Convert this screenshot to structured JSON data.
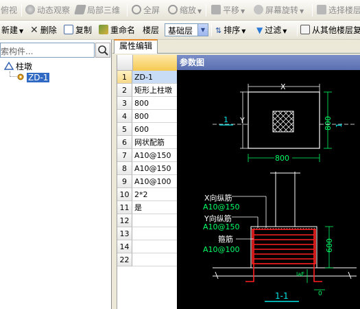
{
  "toolbar1": {
    "items": [
      {
        "label": "俯视",
        "icon": "top-view-icon"
      },
      {
        "label": "动态观察",
        "icon": "orbit-icon"
      },
      {
        "label": "局部三维",
        "icon": "local-3d-icon"
      },
      {
        "label": "全屏",
        "icon": "fullscreen-icon"
      },
      {
        "label": "缩放",
        "icon": "zoom-icon"
      },
      {
        "label": "平移",
        "icon": "pan-icon"
      },
      {
        "label": "屏幕旋转",
        "icon": "screen-rotate-icon"
      },
      {
        "label": "选择楼层",
        "icon": "select-floor-icon"
      }
    ]
  },
  "toolbar2": {
    "new_label": "新建",
    "delete_label": "删除",
    "copy_label": "复制",
    "rename_label": "重命名",
    "floor_label": "楼层",
    "floor_value": "基础层",
    "sort_label": "排序",
    "filter_label": "过滤",
    "copy_from_label": "从其他楼层复"
  },
  "left_panel": {
    "search_placeholder": "搜索构件...",
    "tree_root": "柱墩",
    "tree_child": "ZD-1"
  },
  "properties": {
    "tab_label": "属性编辑",
    "rows": [
      {
        "num": "1",
        "value": "ZD-1"
      },
      {
        "num": "2",
        "value": "矩形上柱墩"
      },
      {
        "num": "3",
        "value": "800"
      },
      {
        "num": "4",
        "value": "800"
      },
      {
        "num": "5",
        "value": "600"
      },
      {
        "num": "6",
        "value": "网状配筋"
      },
      {
        "num": "7",
        "value": "A10@150"
      },
      {
        "num": "8",
        "value": "A10@150"
      },
      {
        "num": "9",
        "value": "A10@100"
      },
      {
        "num": "10",
        "value": "2*2"
      },
      {
        "num": "11",
        "value": "是"
      },
      {
        "num": "12",
        "value": ""
      },
      {
        "num": "13",
        "value": ""
      },
      {
        "num": "14",
        "value": ""
      },
      {
        "num": "22",
        "value": ""
      }
    ]
  },
  "diagram": {
    "title": "参数图",
    "plan": {
      "x_label": "X",
      "y_label": "Y",
      "width_value": "800",
      "height_value": "800",
      "section_left": "1",
      "section_right": "1"
    },
    "section": {
      "x_bar_label": "X向纵筋",
      "x_bar_value": "A10@150",
      "y_bar_label": "Y向纵筋",
      "y_bar_value": "A10@150",
      "stirrup_label": "箍筋",
      "stirrup_value": "A10@100",
      "height_value": "600",
      "lae_label": "laE",
      "zero_label": "0",
      "section_name": "1-1"
    }
  },
  "colors": {
    "accent_tab": "#e68b2c",
    "selection": "#316ac5",
    "diagram_red": "#ff2020",
    "diagram_cyan": "#00e5e5"
  }
}
